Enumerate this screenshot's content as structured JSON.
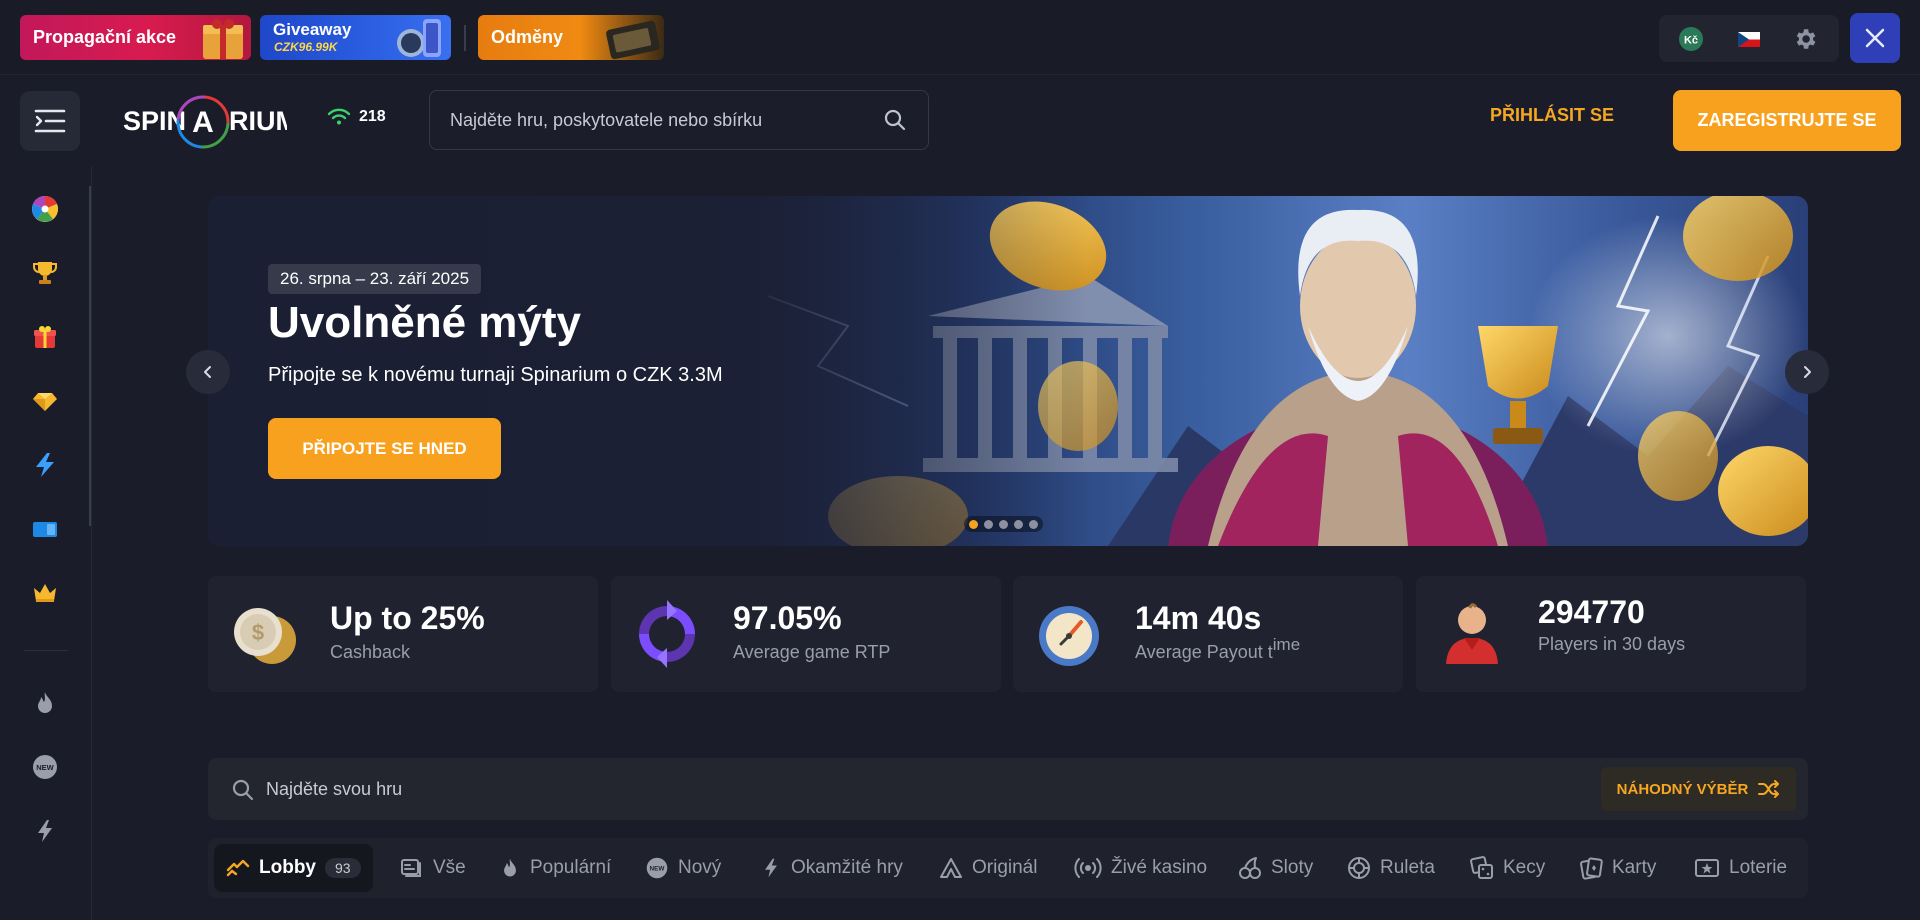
{
  "promos": {
    "propagacni": "Propagační akce",
    "giveaway": "Giveaway",
    "giveaway_amount": "CZK96.99K",
    "odmeny": "Odměny"
  },
  "utilities": {
    "currency": "Kč",
    "language": "CZ flag",
    "settings": "settings"
  },
  "header": {
    "logo": "SPINARIUM",
    "online_count": "218",
    "search_placeholder": "Najděte hru, poskytovatele nebo sbírku",
    "login": "PŘIHLÁSIT SE",
    "register": "ZAREGISTRUJTE SE"
  },
  "sidebar": {
    "items": [
      "wheel-icon",
      "trophy-icon",
      "gift-icon",
      "gem-icon",
      "lightning-icon",
      "ticket-icon",
      "crown-icon",
      "fire-icon",
      "new-icon",
      "instant-icon"
    ]
  },
  "hero": {
    "date": "26. srpna – 23. září 2025",
    "title": "Uvolněné mýty",
    "subtitle": "Připojte se k novému turnaji Spinarium o CZK 3.3M",
    "cta": "PŘIPOJTE SE HNED",
    "slides": 5,
    "active_slide": 1
  },
  "stats": [
    {
      "value": "Up to 25%",
      "label": "Cashback"
    },
    {
      "value": "97.05%",
      "label": "Average game RTP"
    },
    {
      "value": "14m 40s",
      "label": "Average Payout t",
      "label_tail": "ime"
    },
    {
      "value": "294770",
      "label": "Players in 30 days"
    }
  ],
  "game_search": {
    "placeholder": "Najděte svou hru",
    "random": "NÁHODNÝ VÝBĚR"
  },
  "categories": [
    {
      "label": "Lobby",
      "count": "93"
    },
    {
      "label": "Vše"
    },
    {
      "label": "Populární"
    },
    {
      "label": "Nový"
    },
    {
      "label": "Okamžité hry"
    },
    {
      "label": "Originál"
    },
    {
      "label": "Živé kasino"
    },
    {
      "label": "Sloty"
    },
    {
      "label": "Ruleta"
    },
    {
      "label": "Kecy"
    },
    {
      "label": "Karty"
    },
    {
      "label": "Loterie"
    }
  ]
}
